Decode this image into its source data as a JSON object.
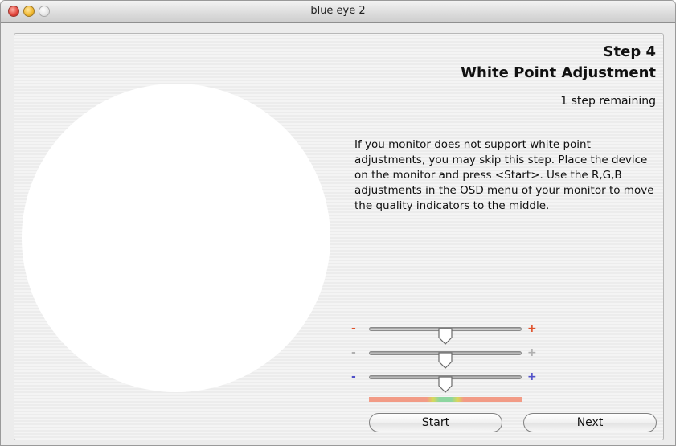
{
  "window": {
    "title": "blue eye 2"
  },
  "step": {
    "title": "Step 4",
    "subtitle": "White Point Adjustment",
    "remaining": "1 step remaining",
    "instructions": "If you monitor does not support white point adjustments, you may skip this step. Place the device on the monitor and press <Start>. Use the R,G,B adjustments in the OSD menu of your monitor to move the quality indicators to the middle."
  },
  "indicators": [
    {
      "channel": "red",
      "minus": "-",
      "plus": "+",
      "color": "#e0502a",
      "level": 0.5
    },
    {
      "channel": "green",
      "minus": "-",
      "plus": "+",
      "color": "#b8b8b8",
      "level": 0.5
    },
    {
      "channel": "blue",
      "minus": "-",
      "plus": "+",
      "color": "#5050c8",
      "level": 0.5
    }
  ],
  "buttons": {
    "start": "Start",
    "next": "Next"
  },
  "icons": {
    "close": "close-icon",
    "minimize": "minimize-icon",
    "zoom": "zoom-icon"
  }
}
